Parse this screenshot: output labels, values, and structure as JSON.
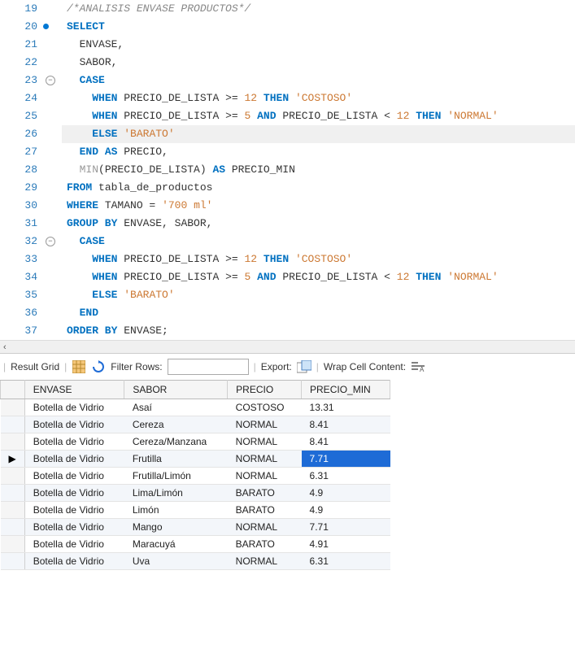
{
  "editor": {
    "lines": [
      {
        "n": "19",
        "html": "<span class='cmt'>/*ANALISIS ENVASE PRODUCTOS*/</span>",
        "indent": 0,
        "dot": false
      },
      {
        "n": "20",
        "html": "<span class='kw'>SELECT</span>",
        "indent": 0,
        "dot": true
      },
      {
        "n": "21",
        "html": "<span class='id'>ENVASE,</span>",
        "indent": 1
      },
      {
        "n": "22",
        "html": "<span class='id'>SABOR,</span>",
        "indent": 1
      },
      {
        "n": "23",
        "html": "<span class='kw'>CASE</span>",
        "indent": 1,
        "fold": true
      },
      {
        "n": "24",
        "html": "<span class='kw'>WHEN</span> <span class='id'>PRECIO_DE_LISTA &gt;=</span> <span class='num'>12</span> <span class='kw'>THEN</span> <span class='str'>'COSTOSO'</span>",
        "indent": 2
      },
      {
        "n": "25",
        "html": "<span class='kw'>WHEN</span> <span class='id'>PRECIO_DE_LISTA &gt;=</span> <span class='num'>5</span> <span class='kw'>AND</span> <span class='id'>PRECIO_DE_LISTA &lt;</span> <span class='num'>12</span> <span class='kw'>THEN</span> <span class='str'>'NORMAL'</span>",
        "indent": 2
      },
      {
        "n": "26",
        "html": "<span class='kw'>ELSE</span> <span class='str'>'BARATO'</span>",
        "indent": 2,
        "hl": true
      },
      {
        "n": "27",
        "html": "<span class='kw'>END</span> <span class='kw'>AS</span> <span class='id'>PRECIO,</span>",
        "indent": 1,
        "foldend": true
      },
      {
        "n": "28",
        "html": "<span class='fn'>MIN</span><span class='id'>(PRECIO_DE_LISTA)</span> <span class='kw'>AS</span> <span class='id'>PRECIO_MIN</span>",
        "indent": 1
      },
      {
        "n": "29",
        "html": "<span class='kw'>FROM</span> <span class='id'>tabla_de_productos</span>",
        "indent": 0
      },
      {
        "n": "30",
        "html": "<span class='kw'>WHERE</span> <span class='id'>TAMANO =</span> <span class='str'>'700 ml'</span>",
        "indent": 0
      },
      {
        "n": "31",
        "html": "<span class='kw'>GROUP BY</span> <span class='id'>ENVASE, SABOR,</span>",
        "indent": 0
      },
      {
        "n": "32",
        "html": "<span class='kw'>CASE</span>",
        "indent": 1,
        "fold": true
      },
      {
        "n": "33",
        "html": "<span class='kw'>WHEN</span> <span class='id'>PRECIO_DE_LISTA &gt;=</span> <span class='num'>12</span> <span class='kw'>THEN</span> <span class='str'>'COSTOSO'</span>",
        "indent": 2
      },
      {
        "n": "34",
        "html": "<span class='kw'>WHEN</span> <span class='id'>PRECIO_DE_LISTA &gt;=</span> <span class='num'>5</span> <span class='kw'>AND</span> <span class='id'>PRECIO_DE_LISTA &lt;</span> <span class='num'>12</span> <span class='kw'>THEN</span> <span class='str'>'NORMAL'</span>",
        "indent": 2
      },
      {
        "n": "35",
        "html": "<span class='kw'>ELSE</span> <span class='str'>'BARATO'</span>",
        "indent": 2
      },
      {
        "n": "36",
        "html": "<span class='kw'>END</span>",
        "indent": 1,
        "foldend": true
      },
      {
        "n": "37",
        "html": "<span class='kw'>ORDER BY</span> <span class='id'>ENVASE;</span>",
        "indent": 0,
        "foldend": true
      }
    ]
  },
  "hscroll_arrow": "‹",
  "toolbar": {
    "result_grid": "Result Grid",
    "filter_rows": "Filter Rows:",
    "filter_value": "",
    "export": "Export:",
    "wrap": "Wrap Cell Content:"
  },
  "grid": {
    "columns": [
      "ENVASE",
      "SABOR",
      "PRECIO",
      "PRECIO_MIN"
    ],
    "selected_row": 3,
    "selected_col": 3,
    "rows": [
      [
        "Botella de Vidrio",
        "Asaí",
        "COSTOSO",
        "13.31"
      ],
      [
        "Botella de Vidrio",
        "Cereza",
        "NORMAL",
        "8.41"
      ],
      [
        "Botella de Vidrio",
        "Cereza/Manzana",
        "NORMAL",
        "8.41"
      ],
      [
        "Botella de Vidrio",
        "Frutilla",
        "NORMAL",
        "7.71"
      ],
      [
        "Botella de Vidrio",
        "Frutilla/Limón",
        "NORMAL",
        "6.31"
      ],
      [
        "Botella de Vidrio",
        "Lima/Limón",
        "BARATO",
        "4.9"
      ],
      [
        "Botella de Vidrio",
        "Limón",
        "BARATO",
        "4.9"
      ],
      [
        "Botella de Vidrio",
        "Mango",
        "NORMAL",
        "7.71"
      ],
      [
        "Botella de Vidrio",
        "Maracuyá",
        "BARATO",
        "4.91"
      ],
      [
        "Botella de Vidrio",
        "Uva",
        "NORMAL",
        "6.31"
      ]
    ]
  }
}
